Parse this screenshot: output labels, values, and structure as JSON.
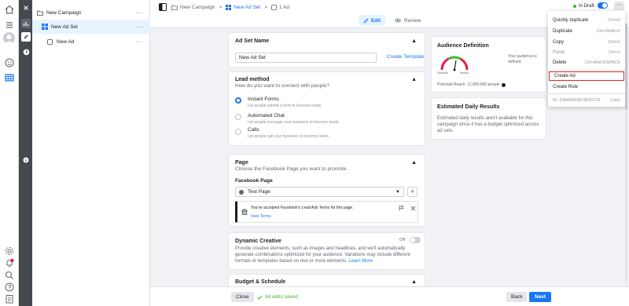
{
  "tree": {
    "campaign": "New Campaign",
    "adset": "New Ad Set",
    "ad": "New Ad",
    "more": "···"
  },
  "breadcrumb": {
    "campaign": "New Campaign",
    "adset": "New Ad Set",
    "ad": "1 Ad",
    "sep": ">"
  },
  "toolbar": {
    "edit": "Edit",
    "review": "Review",
    "status": "In Draft",
    "more": "···"
  },
  "adset_name": {
    "title": "Ad Set Name",
    "value": "New Ad Set",
    "template": "Create Template"
  },
  "lead": {
    "title": "Lead method",
    "subtitle": "How do you want to connect with people?",
    "options": [
      {
        "label": "Instant Forms",
        "desc": "Let people submit a form to become leads.",
        "selected": true
      },
      {
        "label": "Automated Chat",
        "desc": "Let people message your business to become leads.",
        "selected": false
      },
      {
        "label": "Calls",
        "desc": "Let people call your business to become leads.",
        "selected": false
      }
    ]
  },
  "page": {
    "title": "Page",
    "subtitle": "Choose the Facebook Page you want to promote.",
    "label": "Facebook Page",
    "selected": "Test Page",
    "notice": "You've accepted Facebook's Lead Ads Terms for this page.",
    "view_terms": "View Terms"
  },
  "dynamic": {
    "title": "Dynamic Creative",
    "toggle": "Off",
    "text": "Provide creative elements, such as images and headlines, and we'll automatically generate combinations optimized for your audience. Variations may include different formats or templates based on one or more elements.",
    "learn": "Learn More"
  },
  "budget": {
    "title": "Budget & Schedule"
  },
  "audience": {
    "title": "Audience Definition",
    "note": "Your audience is defined.",
    "specific": "Specific",
    "broad": "Broad",
    "reach": "Potential Reach: 12,000,000 people"
  },
  "estimated": {
    "title": "Estimated Daily Results",
    "text": "Estimated daily results aren't available for this campaign since it has a budget optimized across ad sets."
  },
  "menu": {
    "items": [
      {
        "label": "Quickly duplicate",
        "shortcut": "Ctrl+D"
      },
      {
        "label": "Duplicate",
        "shortcut": "Ctrl+Shift+D"
      },
      {
        "label": "Copy",
        "shortcut": "Ctrl+C"
      },
      {
        "label": "Paste",
        "shortcut": "Ctrl+V"
      },
      {
        "label": "Delete",
        "shortcut": "Ctrl+BACKSPACE"
      }
    ],
    "create_ad": "Create Ad",
    "create_rule": "Create Rule",
    "id": "ID: 23848003814630733",
    "copy": "Copy"
  },
  "footer": {
    "close": "Close",
    "saved": "All edits saved",
    "back": "Back",
    "next": "Next"
  },
  "colors": {
    "accent": "#1877f2",
    "success": "#42b72a",
    "highlight": "#e02424"
  }
}
